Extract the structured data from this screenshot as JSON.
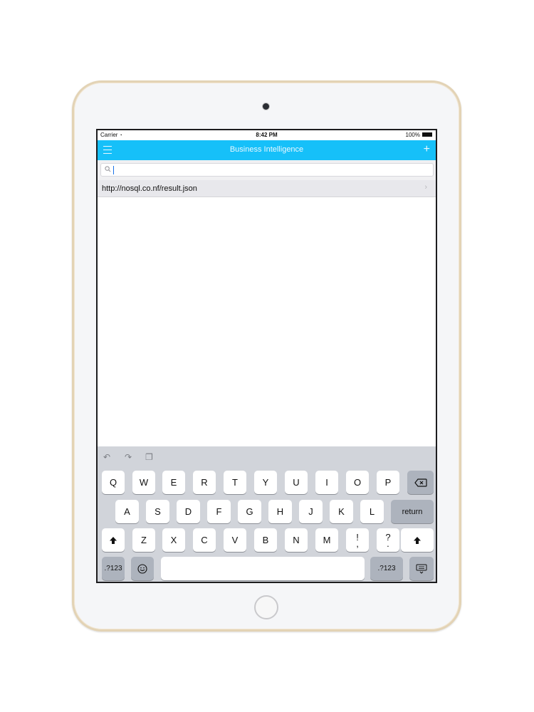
{
  "status_bar": {
    "carrier": "Carrier",
    "time": "8:42 PM",
    "battery": "100%"
  },
  "nav": {
    "title": "Business Intelligence",
    "menu_icon": "hamburger-menu-icon",
    "add_icon": "plus-icon"
  },
  "search": {
    "value": "",
    "placeholder": ""
  },
  "list": {
    "items": [
      {
        "label": "http://nosql.co.nf/result.json"
      }
    ]
  },
  "keyboard": {
    "row1": [
      "Q",
      "W",
      "E",
      "R",
      "T",
      "Y",
      "U",
      "I",
      "O",
      "P"
    ],
    "row2": [
      "A",
      "S",
      "D",
      "F",
      "G",
      "H",
      "J",
      "K",
      "L"
    ],
    "row3": [
      "Z",
      "X",
      "C",
      "V",
      "B",
      "N",
      "M"
    ],
    "punct1": {
      "top": "!",
      "bottom": ","
    },
    "punct2": {
      "top": "?",
      "bottom": "."
    },
    "return_label": "return",
    "numbers_label": ".?123"
  },
  "colors": {
    "nav_bg": "#16c0f9",
    "keyboard_bg": "#d1d4da"
  }
}
